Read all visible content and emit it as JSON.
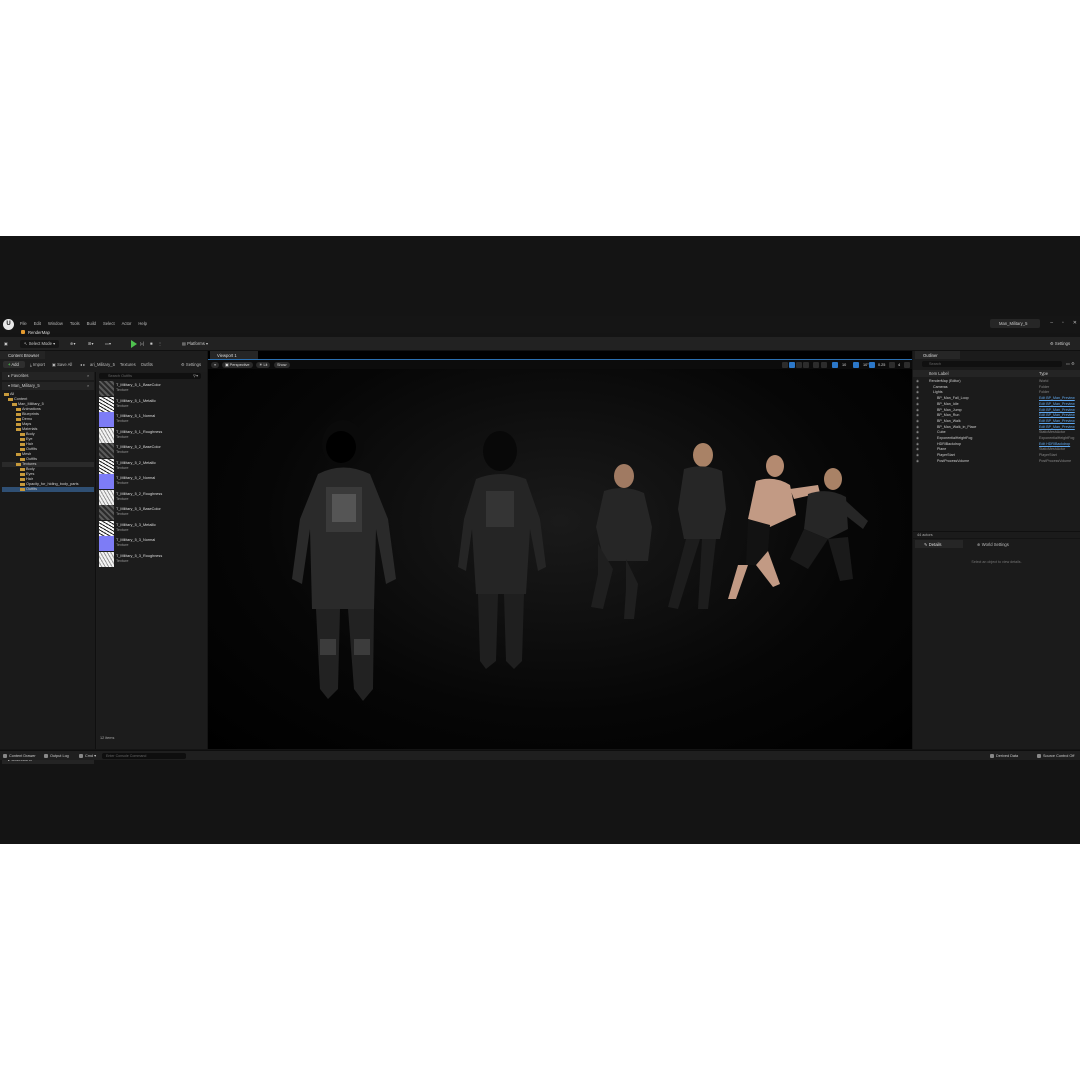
{
  "menu": [
    "File",
    "Edit",
    "Window",
    "Tools",
    "Build",
    "Select",
    "Actor",
    "Help"
  ],
  "project_tab": "Man_Military_5",
  "map_tab": "RenderMap",
  "toolbar": {
    "select_mode": "Select Mode",
    "platforms": "Platforms",
    "settings": "Settings"
  },
  "content_browser": {
    "tab": "Content Browser",
    "add": "Add",
    "import": "Import",
    "save_all": "Save All",
    "breadcrumbs": [
      "ari_Military_5",
      "Textures",
      "Outfits"
    ],
    "settings": "Settings",
    "favorites": "Favorites",
    "project": "Man_Military_5",
    "tree": [
      {
        "label": "All",
        "indent": 0
      },
      {
        "label": "Content",
        "indent": 1
      },
      {
        "label": "Man_Military_5",
        "indent": 2
      },
      {
        "label": "Animations",
        "indent": 3
      },
      {
        "label": "Blueprints",
        "indent": 3
      },
      {
        "label": "Demo",
        "indent": 3
      },
      {
        "label": "Maps",
        "indent": 3
      },
      {
        "label": "Materials",
        "indent": 3
      },
      {
        "label": "Body",
        "indent": 4
      },
      {
        "label": "Eye",
        "indent": 4
      },
      {
        "label": "Hair",
        "indent": 4
      },
      {
        "label": "Outfits",
        "indent": 4
      },
      {
        "label": "Mesh",
        "indent": 3
      },
      {
        "label": "Outfits",
        "indent": 4
      },
      {
        "label": "Textures",
        "indent": 3
      },
      {
        "label": "Body",
        "indent": 4
      },
      {
        "label": "Eyes",
        "indent": 4
      },
      {
        "label": "Hair",
        "indent": 4
      },
      {
        "label": "Opacity_for_hiding_body_parts",
        "indent": 4
      },
      {
        "label": "Outfits",
        "indent": 4
      }
    ],
    "search_placeholder": "Search Outfits",
    "assets": [
      {
        "name": "T_Military_5_1_BaseColor",
        "type": "Texture",
        "kind": "base"
      },
      {
        "name": "T_Military_5_1_Metallic",
        "type": "Texture",
        "kind": "metal"
      },
      {
        "name": "T_Military_5_1_Normal",
        "type": "Texture",
        "kind": "normal"
      },
      {
        "name": "T_Military_5_1_Roughness",
        "type": "Texture",
        "kind": "rough"
      },
      {
        "name": "T_Military_5_2_BaseColor",
        "type": "Texture",
        "kind": "base"
      },
      {
        "name": "T_Military_5_2_Metallic",
        "type": "Texture",
        "kind": "metal"
      },
      {
        "name": "T_Military_5_2_Normal",
        "type": "Texture",
        "kind": "normal"
      },
      {
        "name": "T_Military_5_2_Roughness",
        "type": "Texture",
        "kind": "rough"
      },
      {
        "name": "T_Military_5_3_BaseColor",
        "type": "Texture",
        "kind": "base"
      },
      {
        "name": "T_Military_5_3_Metallic",
        "type": "Texture",
        "kind": "metal"
      },
      {
        "name": "T_Military_5_3_Normal",
        "type": "Texture",
        "kind": "normal"
      },
      {
        "name": "T_Military_5_3_Roughness",
        "type": "Texture",
        "kind": "rough"
      }
    ],
    "item_count": "12 items",
    "collections": "Collections"
  },
  "viewport": {
    "tab": "Viewport 1",
    "perspective": "Perspective",
    "lit": "Lit",
    "show": "Show",
    "grid_snap": "10",
    "rot_snap": "10°",
    "scale_snap": "0.25",
    "cam_speed": "4"
  },
  "outliner": {
    "tab": "Outliner",
    "search_placeholder": "Search",
    "col_label": "Item Label",
    "col_type": "Type",
    "rows": [
      {
        "label": "RenderMap (Editor)",
        "type": "World",
        "indent": 1,
        "link": false
      },
      {
        "label": "Cameras",
        "type": "Folder",
        "indent": 2,
        "link": false
      },
      {
        "label": "Lights",
        "type": "Folder",
        "indent": 2,
        "link": false
      },
      {
        "label": "BP_Man_Fall_Loop",
        "type": "Edit BP_Man_Preview",
        "indent": 3,
        "link": true
      },
      {
        "label": "BP_Man_Idle",
        "type": "Edit BP_Man_Preview",
        "indent": 3,
        "link": true
      },
      {
        "label": "BP_Man_Jump",
        "type": "Edit BP_Man_Preview",
        "indent": 3,
        "link": true
      },
      {
        "label": "BP_Man_Run",
        "type": "Edit BP_Man_Preview",
        "indent": 3,
        "link": true
      },
      {
        "label": "BP_Man_Walk",
        "type": "Edit BP_Man_Preview",
        "indent": 3,
        "link": true
      },
      {
        "label": "BP_Man_Walk_in_Place",
        "type": "Edit BP_Man_Preview",
        "indent": 3,
        "link": true
      },
      {
        "label": "Cube",
        "type": "StaticMeshActor",
        "indent": 3,
        "link": false
      },
      {
        "label": "ExponentialHeightFog",
        "type": "ExponentialHeightFog",
        "indent": 3,
        "link": false
      },
      {
        "label": "HDRIBackdrop",
        "type": "Edit HDRIBackdrop",
        "indent": 3,
        "link": true
      },
      {
        "label": "Plane",
        "type": "StaticMeshActor",
        "indent": 3,
        "link": false
      },
      {
        "label": "PlayerStart",
        "type": "PlayerStart",
        "indent": 3,
        "link": false
      },
      {
        "label": "PostProcessVolume",
        "type": "PostProcessVolume",
        "indent": 3,
        "link": false
      }
    ],
    "footer": "44 actors"
  },
  "details": {
    "tab": "Details",
    "world_settings": "World Settings",
    "empty_msg": "Select an object to view details."
  },
  "statusbar": {
    "content_drawer": "Content Drawer",
    "output_log": "Output Log",
    "cmd": "Cmd",
    "cmd_placeholder": "Enter Console Command",
    "derived_data": "Derived Data",
    "source_control": "Source Control Off"
  }
}
